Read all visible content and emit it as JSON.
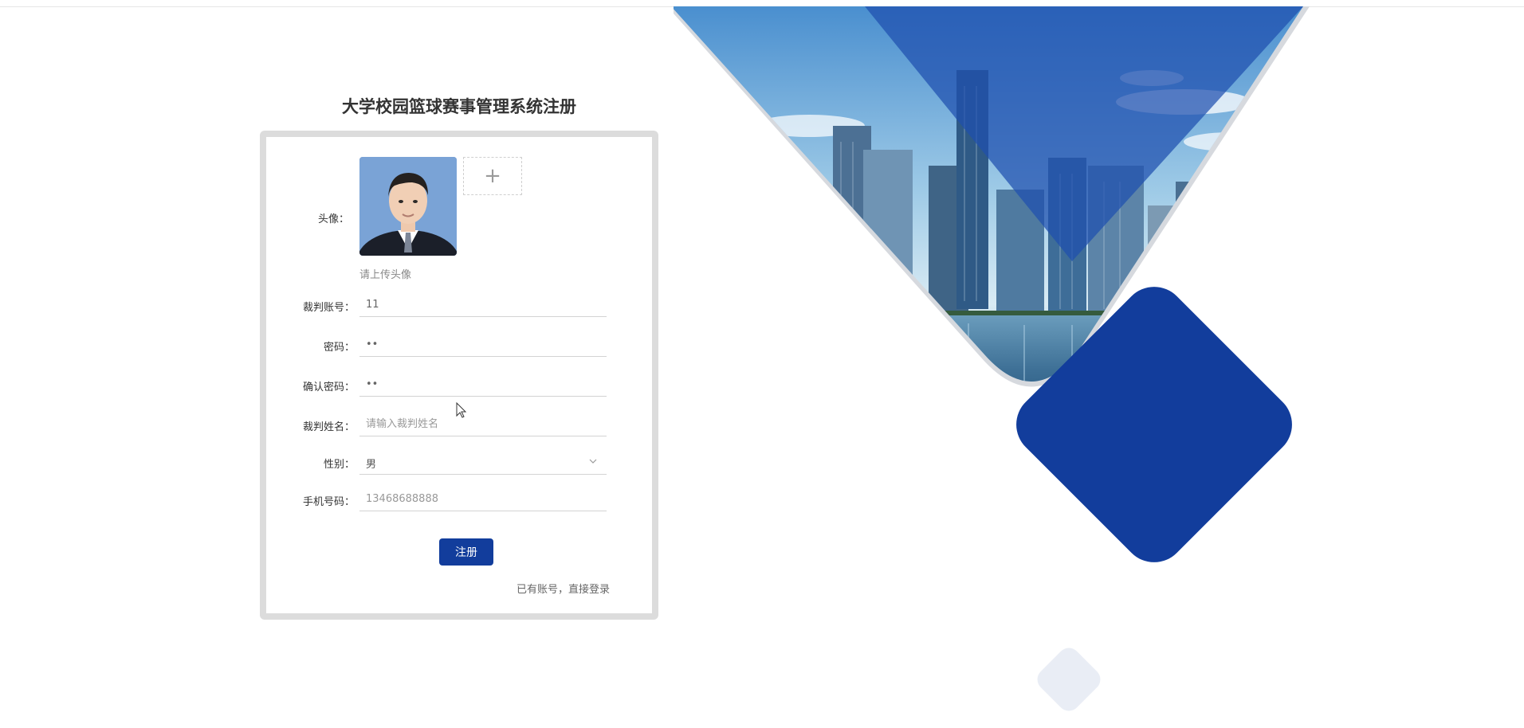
{
  "page": {
    "title": "大学校园篮球赛事管理系统注册"
  },
  "form": {
    "avatar_label": "头像：",
    "avatar_hint": "请上传头像",
    "upload_icon": "plus-icon",
    "upload_symbol": "+",
    "account": {
      "label": "裁判账号：",
      "value": "11"
    },
    "password": {
      "label": "密码：",
      "value": "••"
    },
    "confirm_password": {
      "label": "确认密码：",
      "value": "••"
    },
    "name": {
      "label": "裁判姓名：",
      "placeholder": "请输入裁判姓名",
      "value": ""
    },
    "gender": {
      "label": "性别：",
      "value": "男"
    },
    "phone": {
      "label": "手机号码：",
      "placeholder": "13468688888",
      "value": ""
    },
    "submit_label": "注册",
    "login_link": "已有账号，直接登录"
  },
  "colors": {
    "accent": "#123d9c",
    "card_border": "#dcdcdc",
    "diamond": "#123d9c",
    "diamond_light": "#e9edf5"
  },
  "icons": {
    "dropdown": "chevron-down-icon",
    "pointer": "mouse-pointer-icon"
  }
}
